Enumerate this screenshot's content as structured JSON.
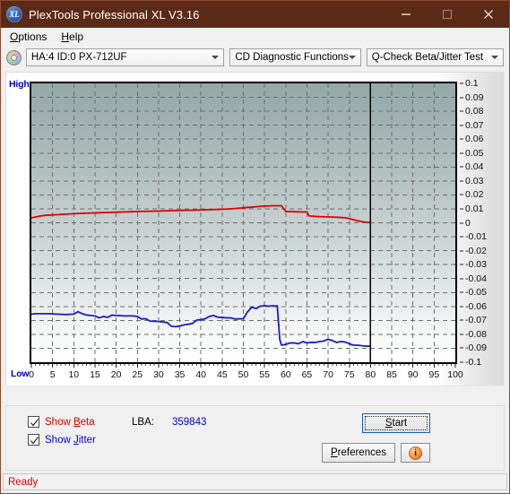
{
  "window": {
    "title": "PlexTools Professional XL V3.16",
    "app_icon": "XL",
    "buttons": {
      "minimize": "minimize-icon",
      "maximize": "maximize-icon",
      "close": "close-icon"
    }
  },
  "menubar": {
    "items": [
      {
        "label": "Options",
        "accel": "O"
      },
      {
        "label": "Help",
        "accel": "H"
      }
    ]
  },
  "toolbar": {
    "disc_icon": "disc-icon",
    "drive_select": "HA:4 ID:0  PX-712UF",
    "function_select": "CD Diagnostic Functions",
    "test_select": "Q-Check Beta/Jitter Test"
  },
  "chart_panel": {
    "axis_high_label": "High",
    "axis_low_label": "Low"
  },
  "controls": {
    "show_beta_label": "Show Beta",
    "show_beta_accel": "B",
    "show_beta_checked": true,
    "show_jitter_label": "Show Jitter",
    "show_jitter_accel": "J",
    "show_jitter_checked": true,
    "lba_label": "LBA:",
    "lba_value": "359843",
    "start_label": "Start",
    "start_accel": "S",
    "preferences_label": "Preferences",
    "preferences_accel": "P",
    "info_icon": "info-icon",
    "info_glyph": "i"
  },
  "statusbar": {
    "text": "Ready"
  },
  "colors": {
    "titlebar": "#5b2a17",
    "beta_line": "#e00000",
    "jitter_line": "#1a1ad0",
    "status_text": "#d40000",
    "accent_blue": "#0000cc"
  },
  "chart_data": {
    "type": "line",
    "title": "Q-Check Beta/Jitter Test",
    "xlabel": "",
    "ylabel": "",
    "xlim": [
      0,
      100
    ],
    "ylim": [
      -0.1,
      0.1
    ],
    "grid": true,
    "legend_position": "external-bottom-left",
    "xticks": [
      0,
      5,
      10,
      15,
      20,
      25,
      30,
      35,
      40,
      45,
      50,
      55,
      60,
      65,
      70,
      75,
      80,
      85,
      90,
      95,
      100
    ],
    "yticks": [
      0.1,
      0.09,
      0.08,
      0.07,
      0.06,
      0.05,
      0.04,
      0.03,
      0.02,
      0.01,
      0,
      -0.01,
      -0.02,
      -0.03,
      -0.04,
      -0.05,
      -0.06,
      -0.07,
      -0.08,
      -0.09,
      -0.1
    ],
    "annotations": [
      {
        "type": "vline",
        "x": 80,
        "color": "#000000",
        "label": "data-end-marker"
      }
    ],
    "data_end_x": 80,
    "series": [
      {
        "name": "Beta",
        "color": "#e00000",
        "x": [
          0,
          1,
          2,
          3,
          4,
          6,
          8,
          10,
          12,
          14,
          16,
          18,
          20,
          22,
          24,
          26,
          28,
          30,
          32,
          34,
          36,
          38,
          40,
          42,
          44,
          46,
          48,
          50,
          52,
          54,
          55,
          56,
          56.5,
          57,
          58,
          59,
          60,
          61,
          62,
          63,
          64,
          65,
          65.5,
          66,
          67,
          68,
          70,
          72,
          74,
          75,
          76,
          77,
          78,
          79,
          80
        ],
        "values": [
          0.0035,
          0.0042,
          0.0048,
          0.0052,
          0.0055,
          0.0058,
          0.0062,
          0.0065,
          0.0068,
          0.007,
          0.0072,
          0.0074,
          0.0076,
          0.0078,
          0.008,
          0.0082,
          0.0083,
          0.0084,
          0.0086,
          0.0088,
          0.009,
          0.009,
          0.0092,
          0.0094,
          0.0096,
          0.0098,
          0.0102,
          0.0108,
          0.0112,
          0.0118,
          0.012,
          0.012,
          0.0122,
          0.0122,
          0.0122,
          0.0122,
          0.0082,
          0.008,
          0.008,
          0.0078,
          0.0078,
          0.0078,
          0.005,
          0.0048,
          0.0046,
          0.0044,
          0.0042,
          0.004,
          0.0036,
          0.003,
          0.0022,
          0.0014,
          0.0008,
          0.0004,
          0.0002
        ]
      },
      {
        "name": "Jitter",
        "color": "#1a1ad0",
        "x": [
          0,
          1,
          2,
          4,
          6,
          8,
          10,
          11,
          12,
          13,
          14,
          15,
          16,
          17,
          18,
          19,
          20,
          22,
          24,
          25,
          26,
          27,
          28,
          30,
          32,
          33,
          34,
          35,
          36,
          37,
          38,
          39,
          40,
          41,
          42,
          43,
          44,
          45,
          46,
          47,
          48,
          50,
          51,
          52,
          53,
          54,
          55,
          56,
          57,
          57.5,
          58,
          58.3,
          58.6,
          59,
          60,
          61,
          62,
          63,
          64,
          65,
          66,
          67,
          68,
          69,
          70,
          71,
          72,
          73,
          74,
          75,
          76,
          77,
          78,
          79,
          80
        ],
        "values": [
          -0.0655,
          -0.0652,
          -0.0652,
          -0.0652,
          -0.0655,
          -0.0658,
          -0.0655,
          -0.0638,
          -0.0652,
          -0.0662,
          -0.0665,
          -0.0668,
          -0.0682,
          -0.0672,
          -0.0678,
          -0.0662,
          -0.0665,
          -0.0668,
          -0.0668,
          -0.0672,
          -0.069,
          -0.0688,
          -0.0705,
          -0.0708,
          -0.0715,
          -0.0742,
          -0.0745,
          -0.074,
          -0.0732,
          -0.0728,
          -0.0722,
          -0.0698,
          -0.0695,
          -0.0688,
          -0.0672,
          -0.0665,
          -0.0678,
          -0.0678,
          -0.0682,
          -0.0682,
          -0.069,
          -0.0688,
          -0.0638,
          -0.0605,
          -0.0615,
          -0.0598,
          -0.0595,
          -0.0598,
          -0.0595,
          -0.0598,
          -0.0595,
          -0.072,
          -0.0838,
          -0.0878,
          -0.0872,
          -0.0862,
          -0.0862,
          -0.0868,
          -0.0852,
          -0.0862,
          -0.0858,
          -0.0858,
          -0.0852,
          -0.0848,
          -0.0835,
          -0.0845,
          -0.0858,
          -0.0852,
          -0.0855,
          -0.0868,
          -0.0878,
          -0.0878,
          -0.0882,
          -0.0885,
          -0.0885
        ]
      }
    ]
  }
}
